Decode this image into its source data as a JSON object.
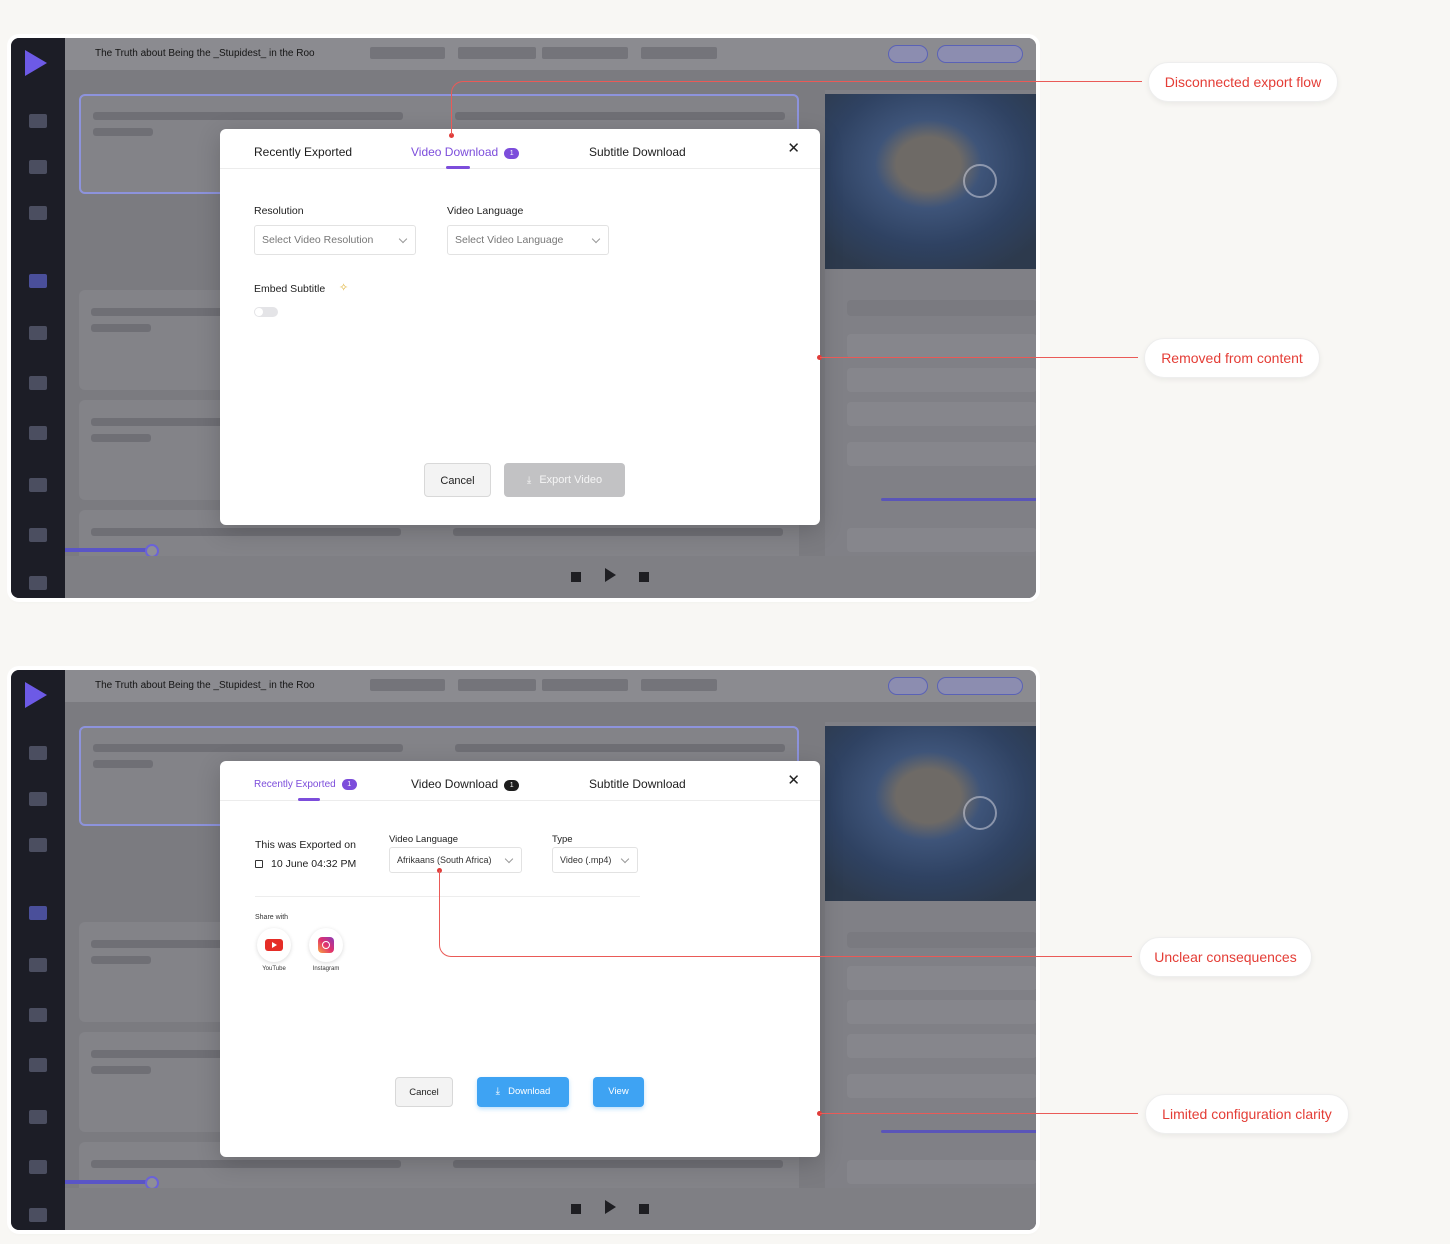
{
  "app": {
    "title": "The Truth about Being the _Stupidest_ in the Roo"
  },
  "modal_1": {
    "tabs": [
      {
        "label": "Recently Exported"
      },
      {
        "label": "Video Download",
        "badge": "1"
      },
      {
        "label": "Subtitle Download"
      }
    ],
    "resolution_label": "Resolution",
    "resolution_placeholder": "Select Video Resolution",
    "language_label": "Video Language",
    "language_placeholder": "Select Video Language",
    "embed_label": "Embed Subtitle",
    "cancel_label": "Cancel",
    "export_label": "Export Video"
  },
  "modal_2": {
    "tabs": [
      {
        "label": "Recently Exported",
        "badge": "1"
      },
      {
        "label": "Video Download",
        "badge": "1"
      },
      {
        "label": "Subtitle Download"
      }
    ],
    "exported_on_label": "This was Exported on",
    "exported_date": "10 June  04:32 PM",
    "language_label": "Video Language",
    "language_value": "Afrikaans (South Africa)",
    "type_label": "Type",
    "type_value": "Video (.mp4)",
    "share_label": "Share with",
    "share_targets": [
      {
        "label": "YouTube",
        "icon": "youtube-icon"
      },
      {
        "label": "Instagram",
        "icon": "instagram-icon"
      }
    ],
    "cancel_label": "Cancel",
    "download_label": "Download",
    "view_label": "View"
  },
  "callouts": [
    {
      "label": "Disconnected export flow"
    },
    {
      "label": "Removed from content"
    },
    {
      "label": "Unclear consequences"
    },
    {
      "label": "Limited configuration clarity"
    }
  ],
  "colors": {
    "accent": "#7c4ddb",
    "primary_button": "#3ea3f3",
    "callout": "#e43d36"
  }
}
